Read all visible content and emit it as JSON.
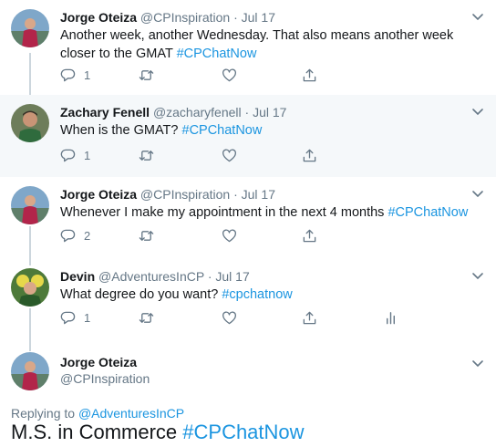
{
  "tweets": [
    {
      "name": "Jorge Oteiza",
      "handle": "@CPInspiration",
      "dot": "·",
      "date": "Jul 17",
      "text": "Another week, another Wednesday.  That also means another week closer to the GMAT ",
      "hashtag": "#CPChatNow",
      "reply_count": "1"
    },
    {
      "name": "Zachary Fenell",
      "handle": "@zacharyfenell",
      "dot": "·",
      "date": "Jul 17",
      "text": "When is the GMAT? ",
      "hashtag": "#CPChatNow",
      "reply_count": "1"
    },
    {
      "name": "Jorge Oteiza",
      "handle": "@CPInspiration",
      "dot": "·",
      "date": "Jul 17",
      "text": "Whenever I make my appointment in the next 4 months ",
      "hashtag": "#CPChatNow",
      "reply_count": "2"
    },
    {
      "name": "Devin",
      "handle": "@AdventuresInCP",
      "dot": "·",
      "date": "Jul 17",
      "text": "What degree do you want? ",
      "hashtag": "#cpchatnow",
      "reply_count": "1"
    }
  ],
  "main_tweet": {
    "name": "Jorge Oteiza",
    "handle": "@CPInspiration",
    "replying_prefix": "Replying to ",
    "replying_to": "@AdventuresInCP",
    "text": "M.S. in Commerce ",
    "hashtag": "#CPChatNow"
  },
  "colors": {
    "link": "#1b95e0",
    "secondary_text": "#657786",
    "thread_line": "#ccd6dd",
    "highlight_bg": "#f5f8fa"
  },
  "icons": [
    "reply-icon",
    "retweet-icon",
    "like-icon",
    "share-icon",
    "analytics-icon",
    "chevron-down-icon"
  ]
}
